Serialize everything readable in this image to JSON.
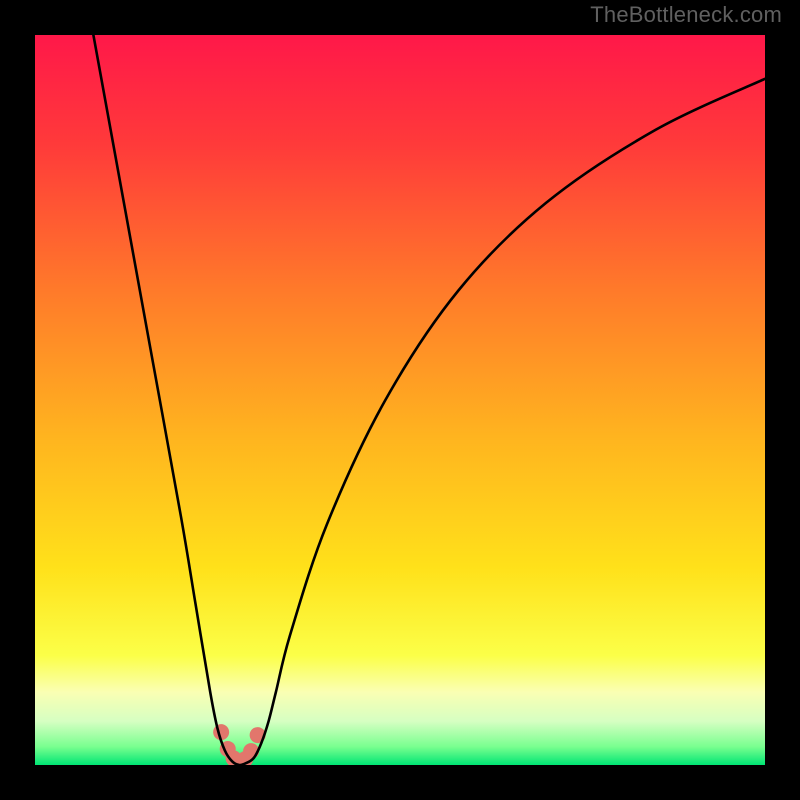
{
  "watermark": "TheBottleneck.com",
  "chart_data": {
    "type": "line",
    "title": "",
    "xlabel": "",
    "ylabel": "",
    "xlim": [
      0,
      100
    ],
    "ylim": [
      0,
      100
    ],
    "grid": false,
    "legend": false,
    "annotations": [],
    "background_gradient_stops": [
      {
        "offset": 0.0,
        "color": "#ff1849"
      },
      {
        "offset": 0.15,
        "color": "#ff3a3a"
      },
      {
        "offset": 0.35,
        "color": "#ff7a2a"
      },
      {
        "offset": 0.55,
        "color": "#ffb41f"
      },
      {
        "offset": 0.73,
        "color": "#ffe11a"
      },
      {
        "offset": 0.85,
        "color": "#fbff48"
      },
      {
        "offset": 0.9,
        "color": "#faffb3"
      },
      {
        "offset": 0.94,
        "color": "#d6ffc2"
      },
      {
        "offset": 0.975,
        "color": "#79ff8f"
      },
      {
        "offset": 1.0,
        "color": "#00e574"
      }
    ],
    "series": [
      {
        "name": "bottleneck-curve",
        "stroke": "#000000",
        "stroke_width": 2.6,
        "x": [
          8,
          12,
          16,
          20,
          22,
          24,
          25,
          26,
          27,
          28,
          29,
          30,
          31,
          32,
          33,
          35,
          40,
          48,
          58,
          70,
          85,
          100
        ],
        "values": [
          100,
          78,
          56,
          34,
          22,
          10,
          5,
          2,
          0.5,
          0,
          0.3,
          1,
          3,
          6,
          10,
          18,
          33,
          50,
          65,
          77,
          87,
          94
        ]
      },
      {
        "name": "minimum-markers",
        "type": "scatter",
        "color": "#e2766c",
        "radius": 8,
        "x": [
          25.5,
          26.4,
          27.2,
          28.0,
          28.8,
          29.6,
          30.5
        ],
        "values": [
          4.5,
          2.2,
          0.9,
          0.4,
          0.8,
          1.9,
          4.1
        ]
      }
    ]
  }
}
